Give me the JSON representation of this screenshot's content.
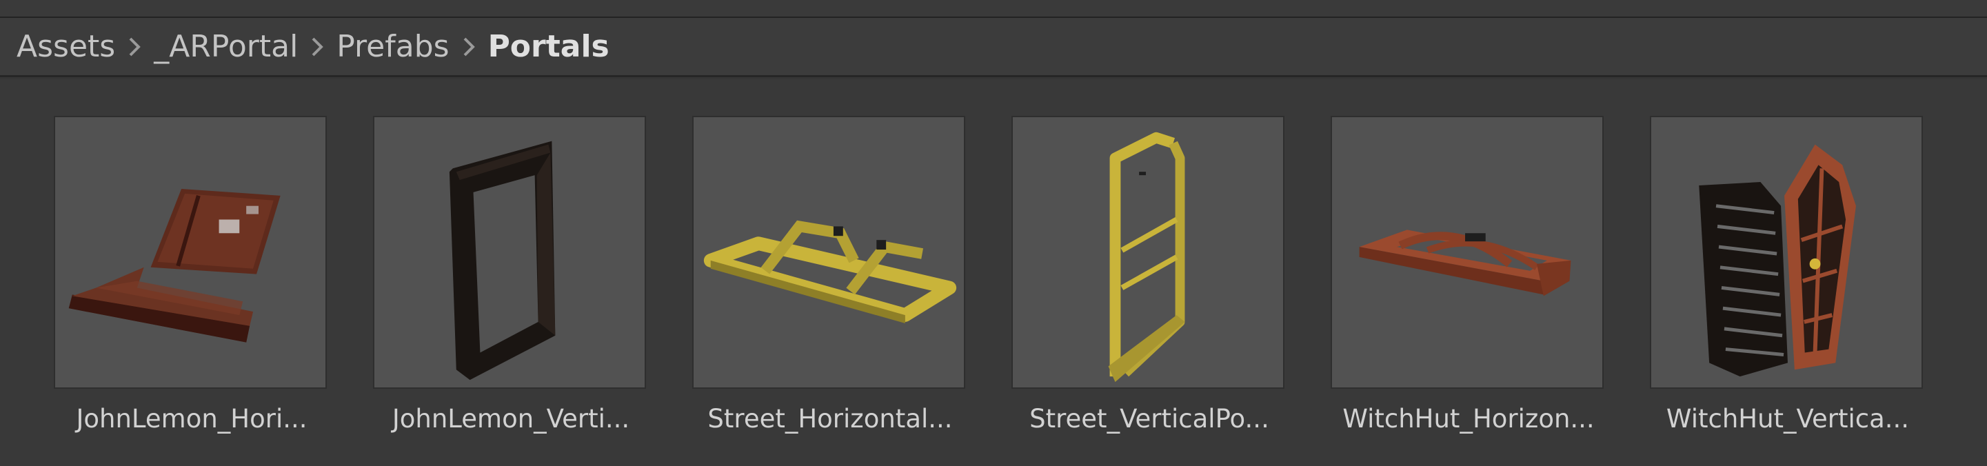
{
  "breadcrumb": {
    "items": [
      "Assets",
      "_ARPortal",
      "Prefabs",
      "Portals"
    ]
  },
  "assets": [
    {
      "label": "JohnLemon_Hori...",
      "icon": "horizontal-portal-prefab-icon"
    },
    {
      "label": "JohnLemon_Verti...",
      "icon": "vertical-portal-prefab-icon"
    },
    {
      "label": "Street_Horizontal...",
      "icon": "horizontal-portal-prefab-icon"
    },
    {
      "label": "Street_VerticalPo...",
      "icon": "vertical-portal-prefab-icon"
    },
    {
      "label": "WitchHut_Horizon...",
      "icon": "horizontal-portal-prefab-icon"
    },
    {
      "label": "WitchHut_Vertica...",
      "icon": "vertical-portal-prefab-icon"
    }
  ],
  "colors": {
    "panel_bg": "#393939",
    "thumb_bg": "#525252",
    "johnlemon_wood": "#5a2a1c",
    "street_yellow": "#c9b43a",
    "witchhut_wood": "#9b4a2e"
  }
}
